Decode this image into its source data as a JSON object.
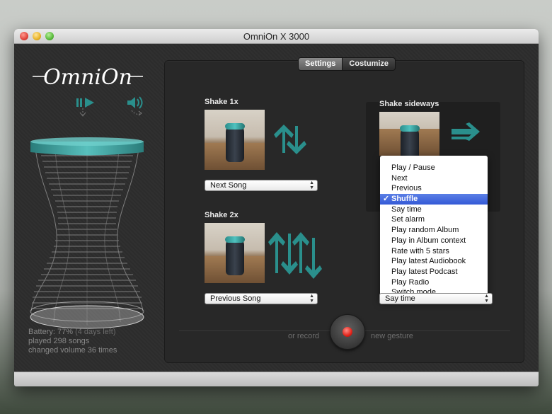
{
  "window": {
    "title": "OmniOn X 3000"
  },
  "brand": {
    "logo_text": "OmniOn"
  },
  "sidebar": {
    "controls": [
      {
        "name": "play-pause-icon"
      },
      {
        "name": "volume-icon"
      }
    ],
    "stats": {
      "battery_label": "Battery:",
      "battery_value": "77%",
      "battery_note": "(4 days left)",
      "played": "played 298 songs",
      "volume": "changed volume 36 times"
    }
  },
  "tabs": [
    {
      "label": "Settings",
      "active": true
    },
    {
      "label": "Costumize",
      "active": false
    }
  ],
  "gestures": [
    {
      "title": "Shake 1x",
      "action": "Next Song",
      "arrow": "up-down-arrows-icon"
    },
    {
      "title": "Shake 2x",
      "action": "Previous Song",
      "arrow": "double-up-down-arrows-icon"
    },
    {
      "title": "Shake sideways",
      "action": "Say time",
      "arrow": "right-arrow-icon"
    }
  ],
  "dropdown": {
    "selected": "Shuffle",
    "check": "✓",
    "options": [
      "Play / Pause",
      "Next",
      "Previous",
      "Shuffle",
      "Say time",
      "Set alarm",
      "Play random Album",
      "Play in Album context",
      "Rate with 5 stars",
      "Play latest Audiobook",
      "Play latest Podcast",
      "Play Radio",
      "Switch mode"
    ]
  },
  "record": {
    "left_text": "or record",
    "right_text": "new gesture"
  },
  "colors": {
    "accent": "#2a8f8c",
    "record": "#e2231a",
    "panel": "#282828"
  }
}
